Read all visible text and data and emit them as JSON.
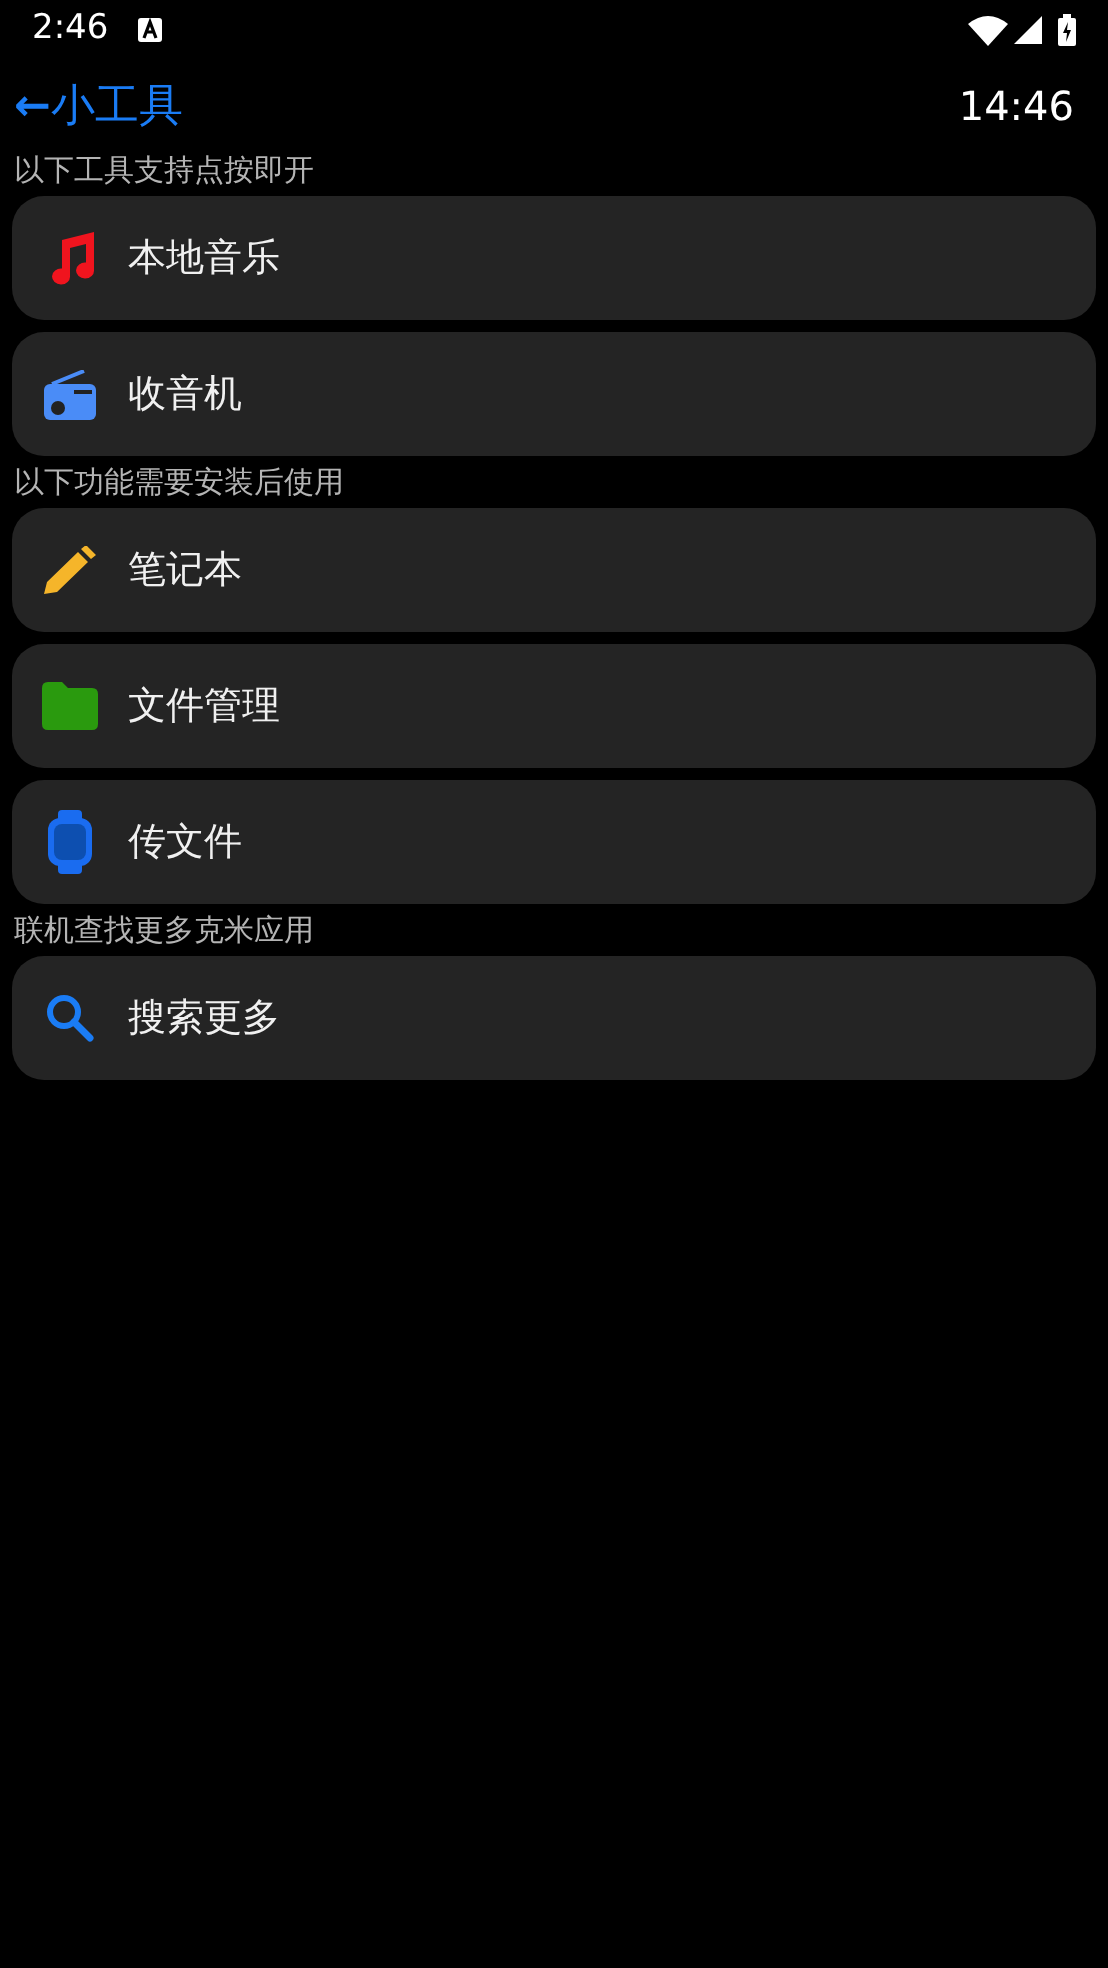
{
  "status_bar": {
    "time": "2:46"
  },
  "header": {
    "back": "←",
    "title": "小工具",
    "clock": "14:46"
  },
  "sections": [
    {
      "heading": "以下工具支持点按即开",
      "items": [
        {
          "label": "本地音乐"
        },
        {
          "label": "收音机"
        }
      ]
    },
    {
      "heading": "以下功能需要安装后使用",
      "items": [
        {
          "label": "笔记本"
        },
        {
          "label": "文件管理"
        },
        {
          "label": "传文件"
        }
      ]
    },
    {
      "heading": "联机查找更多克米应用",
      "items": [
        {
          "label": "搜索更多"
        }
      ]
    }
  ]
}
